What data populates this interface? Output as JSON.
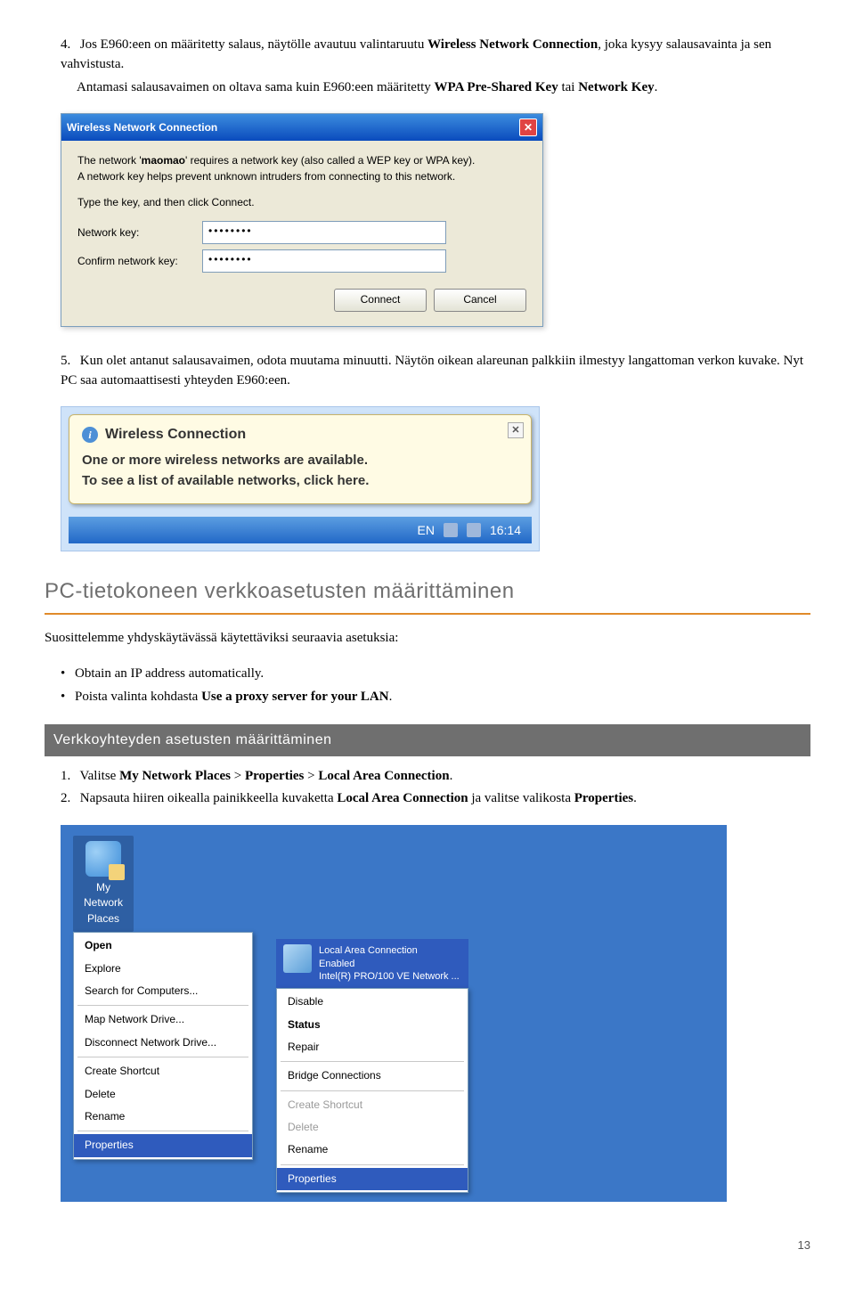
{
  "intro": {
    "item4_prefix": "4.",
    "item4_text_a": "Jos E960:een on määritetty salaus, näytölle avautuu valintaruutu ",
    "item4_bold": "Wireless Network Connection",
    "item4_text_b": ", joka kysyy salausavainta ja sen vahvistusta.",
    "item4_line2_a": "Antamasi salausavaimen on oltava sama kuin E960:een määritetty ",
    "item4_line2_bold": "WPA Pre-Shared Key",
    "item4_line2_b": " tai ",
    "item4_line2_bold2": "Network Key",
    "item4_line2_c": "."
  },
  "dialog": {
    "title": "Wireless Network Connection",
    "line1a": "The network '",
    "line1name": "maomao",
    "line1b": "' requires a network key (also called a WEP key or WPA key).",
    "line2": "A network key helps prevent unknown intruders from connecting to this network.",
    "line3": "Type the key, and then click Connect.",
    "label_key": "Network key:",
    "label_confirm": "Confirm network key:",
    "val_key": "••••••••",
    "val_confirm": "••••••••",
    "btn_connect": "Connect",
    "btn_cancel": "Cancel"
  },
  "step5": {
    "prefix": "5.",
    "text": "Kun olet antanut salausavaimen, odota muutama minuutti. Näytön oikean alareunan palkkiin ilmestyy langattoman verkon kuvake. Nyt PC saa automaattisesti yhteyden E960:een."
  },
  "balloon": {
    "title": "Wireless Connection",
    "line1": "One or more wireless networks are available.",
    "line2": "To see a list of available networks, click here.",
    "lang": "EN",
    "time": "16:14"
  },
  "sec1": {
    "heading": "PC-tietokoneen verkkoasetusten määrittäminen",
    "intro": "Suosittelemme yhdyskäytävässä käytettäviksi seuraavia asetuksia:",
    "bullet1": "Obtain an IP address automatically.",
    "bullet2_a": "Poista valinta kohdasta ",
    "bullet2_bold": "Use a proxy server for your LAN",
    "bullet2_b": "."
  },
  "sub1": {
    "heading": "Verkkoyhteyden asetusten määrittäminen",
    "item1_prefix": "1.",
    "item1_a": "Valitse ",
    "item1_b1": "My Network Places",
    "item1_sep1": " > ",
    "item1_b2": "Properties",
    "item1_sep2": " > ",
    "item1_b3": "Local Area Connection",
    "item1_c": ".",
    "item2_prefix": "2.",
    "item2_a": "Napsauta hiiren oikealla painikkeella kuvaketta ",
    "item2_b": "Local Area Connection",
    "item2_c": " ja valitse valikosta ",
    "item2_d": "Properties",
    "item2_e": "."
  },
  "desktop": {
    "icon_label": "My Network Places",
    "conn": {
      "title": "Local Area Connection",
      "status": "Enabled",
      "adapter": "Intel(R) PRO/100 VE Network ..."
    },
    "menu1": [
      "Open",
      "Explore",
      "Search for Computers...",
      "Map Network Drive...",
      "Disconnect Network Drive...",
      "Create Shortcut",
      "Delete",
      "Rename",
      "Properties"
    ],
    "menu2": [
      "Disable",
      "Status",
      "Repair",
      "Bridge Connections",
      "Create Shortcut",
      "Delete",
      "Rename",
      "Properties"
    ]
  },
  "page_number": "13"
}
